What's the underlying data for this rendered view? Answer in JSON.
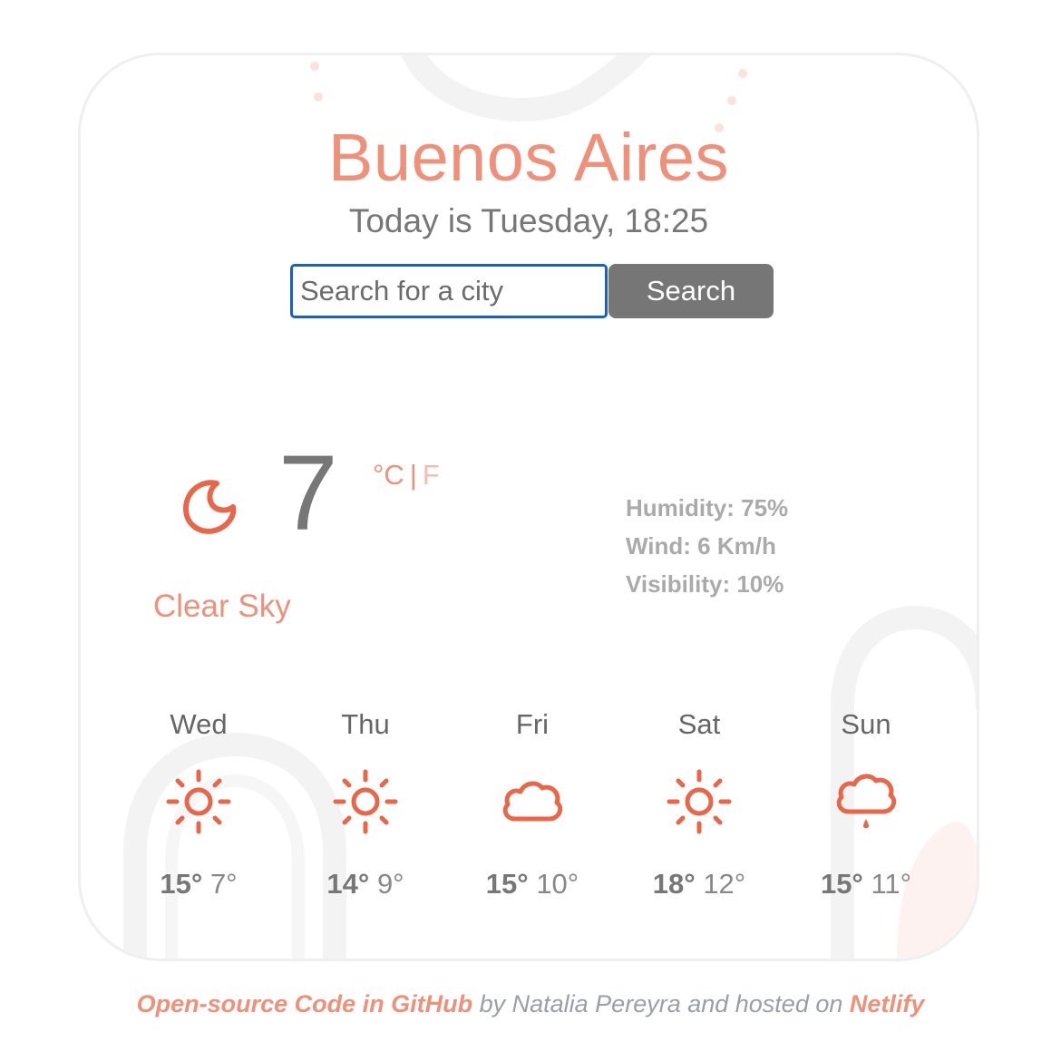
{
  "header": {
    "city": "Buenos Aires",
    "date_text": "Today is Tuesday, 18:25"
  },
  "search": {
    "placeholder": "Search for a city",
    "value": "",
    "button_label": "Search"
  },
  "current": {
    "icon": "moon-icon",
    "temperature": "7",
    "unit_celsius": "°C",
    "unit_separator": "|",
    "unit_fahrenheit": "F",
    "description": "Clear Sky",
    "humidity": "Humidity: 75%",
    "wind": "Wind: 6 Km/h",
    "visibility": "Visibility: 10%"
  },
  "forecast": [
    {
      "day": "Wed",
      "icon": "sun-icon",
      "max": "15°",
      "min": "7°"
    },
    {
      "day": "Thu",
      "icon": "sun-icon",
      "max": "14°",
      "min": "9°"
    },
    {
      "day": "Fri",
      "icon": "cloud-icon",
      "max": "15°",
      "min": "10°"
    },
    {
      "day": "Sat",
      "icon": "sun-icon",
      "max": "18°",
      "min": "12°"
    },
    {
      "day": "Sun",
      "icon": "rain-cloud-icon",
      "max": "15°",
      "min": "11°"
    }
  ],
  "footer": {
    "link_code": "Open-source Code in GitHub",
    "text_middle": " by Natalia Pereyra and hosted on ",
    "link_host": "Netlify"
  },
  "colors": {
    "accent": "#ef917a",
    "icon": "#e8674a",
    "button": "#767676",
    "input_border": "#1a5fc6"
  }
}
